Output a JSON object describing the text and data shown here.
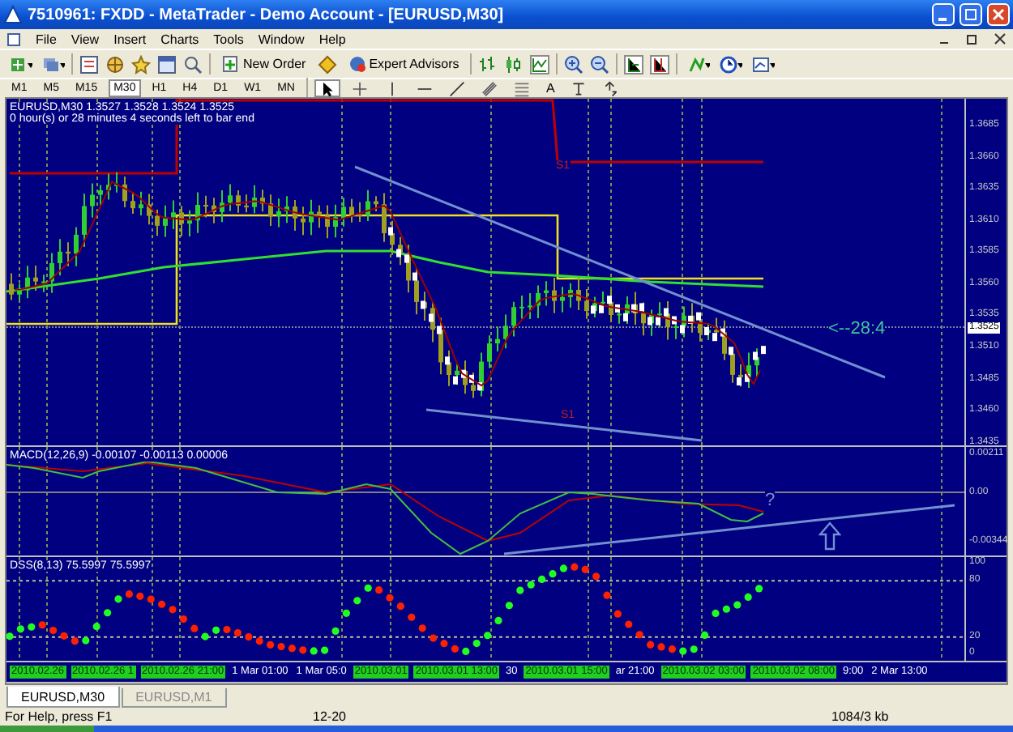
{
  "window": {
    "title": "7510961: FXDD - MetaTrader - Demo Account - [EURUSD,M30]"
  },
  "menu": [
    "File",
    "View",
    "Insert",
    "Charts",
    "Tools",
    "Window",
    "Help"
  ],
  "toolbar": {
    "buttons": [
      {
        "label": "New Order"
      },
      {
        "label": "Expert Advisors"
      }
    ]
  },
  "timeframes": [
    {
      "label": "M1",
      "selected": false
    },
    {
      "label": "M5",
      "selected": false
    },
    {
      "label": "M15",
      "selected": false
    },
    {
      "label": "M30",
      "selected": true
    },
    {
      "label": "H1",
      "selected": false
    },
    {
      "label": "H4",
      "selected": false
    },
    {
      "label": "D1",
      "selected": false
    },
    {
      "label": "W1",
      "selected": false
    },
    {
      "label": "MN",
      "selected": false
    }
  ],
  "drawing_tools": [
    {
      "kind": "cursor",
      "selected": true
    },
    {
      "kind": "crosshair",
      "selected": false
    },
    {
      "kind": "vline",
      "selected": false
    },
    {
      "kind": "hline",
      "selected": false
    },
    {
      "kind": "trendline",
      "selected": false
    },
    {
      "kind": "channel",
      "selected": false
    },
    {
      "kind": "fibo",
      "selected": false
    },
    {
      "kind": "text",
      "label": "A",
      "selected": false
    },
    {
      "kind": "label",
      "selected": false
    },
    {
      "kind": "arrows",
      "selected": false
    }
  ],
  "chart": {
    "symbol_line": "EURUSD,M30  1.3527 1.3528 1.3524 1.3525",
    "timer": "0 hour(s) or 28 minutes 4 seconds left to bar end",
    "countdown": "<--28:4",
    "level_labels": [
      "S1",
      "S1"
    ],
    "price_axis": [
      {
        "label": "1.3685",
        "current": false
      },
      {
        "label": "1.3660",
        "current": false
      },
      {
        "label": "1.3635",
        "current": false
      },
      {
        "label": "1.3610",
        "current": false
      },
      {
        "label": "1.3585",
        "current": false
      },
      {
        "label": "1.3560",
        "current": false
      },
      {
        "label": "1.3535",
        "current": false
      },
      {
        "label": "1.3525",
        "current": true
      },
      {
        "label": "1.3510",
        "current": false
      },
      {
        "label": "1.3485",
        "current": false
      },
      {
        "label": "1.3460",
        "current": false
      },
      {
        "label": "1.3435",
        "current": false
      }
    ]
  },
  "macd": {
    "title": "MACD(12,26,9) -0.00107 -0.00113 0.00006",
    "axis": [
      "0.00211",
      "0.00",
      "-0.00344"
    ],
    "note": "?"
  },
  "dss": {
    "title": "DSS(8,13) 75.5997 75.5997",
    "axis": [
      "100",
      "80",
      "20",
      "0"
    ]
  },
  "time_axis": [
    {
      "label": "2010.02.26",
      "highlight": true
    },
    {
      "label": "2010.02.26 1",
      "highlight": true
    },
    {
      "label": "2010.02.26 21:00",
      "highlight": true
    },
    {
      "label": "1 Mar 01:00",
      "highlight": false
    },
    {
      "label": "1 Mar 05:0",
      "highlight": false
    },
    {
      "label": "2010.03.01",
      "highlight": true
    },
    {
      "label": "2010.03.01 13:00",
      "highlight": true
    },
    {
      "label": "30",
      "highlight": false
    },
    {
      "label": "2010.03.01 15:00",
      "highlight": true
    },
    {
      "label": "ar 21:00",
      "highlight": false
    },
    {
      "label": "2010.03.02 03:00",
      "highlight": true
    },
    {
      "label": "2010.03.02 08:00",
      "highlight": true
    },
    {
      "label": "9:00",
      "highlight": false
    },
    {
      "label": "2 Mar 13:00",
      "highlight": false
    }
  ],
  "tabs": [
    {
      "label": "EURUSD,M30",
      "selected": true
    },
    {
      "label": "EURUSD,M1",
      "selected": false
    }
  ],
  "status_bar": [
    "For Help, press F1",
    "12-20",
    "1084/3 kb"
  ]
}
